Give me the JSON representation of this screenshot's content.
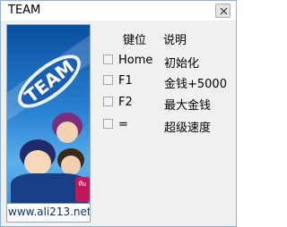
{
  "window": {
    "title": "TEAM",
    "close_icon": "close-icon"
  },
  "banner": {
    "site": "www.ali213.net",
    "logo_text": "TEAM",
    "side_badge": "ทีม"
  },
  "table": {
    "headers": {
      "key": "键位",
      "desc": "说明"
    },
    "rows": [
      {
        "key": "Home",
        "desc": "初始化",
        "checked": false
      },
      {
        "key": "F1",
        "desc": "金钱+5000",
        "checked": false
      },
      {
        "key": "F2",
        "desc": "最大金钱",
        "checked": false
      },
      {
        "key": "=",
        "desc": "超级速度",
        "checked": false
      }
    ]
  },
  "colors": {
    "banner_top": "#0b4fa0",
    "banner_bottom": "#5cb0ea",
    "site_text": "#0c2f66"
  }
}
